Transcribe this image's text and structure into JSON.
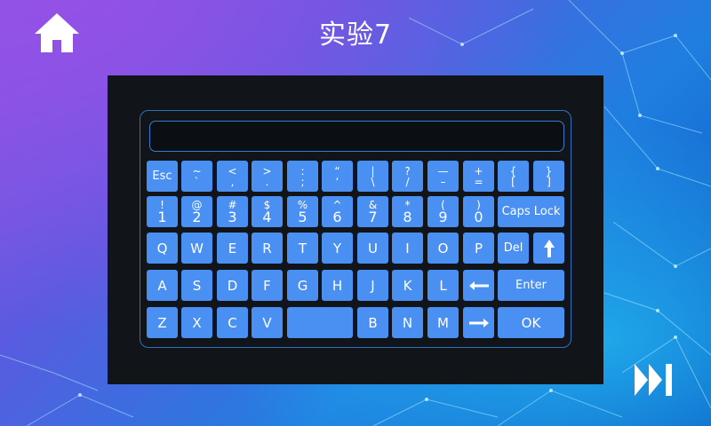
{
  "header": {
    "title": "实验7"
  },
  "icons": {
    "home": "home-icon",
    "skip": "fast-forward-icon",
    "backspace": "arrow-left-icon",
    "forward": "arrow-right-icon",
    "shift": "arrow-up-icon"
  },
  "colors": {
    "key": "#4a90f2",
    "panel": "#111519",
    "frame": "#2f6fbf"
  },
  "keyboard": {
    "display_value": "",
    "row1": [
      {
        "label": "Esc"
      },
      {
        "top": "~",
        "bottom": "`"
      },
      {
        "top": "<",
        "bottom": ","
      },
      {
        "top": ">",
        "bottom": "."
      },
      {
        "top": ":",
        "bottom": ";"
      },
      {
        "top": "“",
        "bottom": "‘"
      },
      {
        "top": "|",
        "bottom": "\\"
      },
      {
        "top": "?",
        "bottom": "/"
      },
      {
        "top": "—",
        "bottom": "–"
      },
      {
        "top": "+",
        "bottom": "="
      },
      {
        "top": "{",
        "bottom": "["
      },
      {
        "top": "}",
        "bottom": "]"
      }
    ],
    "row2": [
      {
        "top": "!",
        "bottom": "1"
      },
      {
        "top": "@",
        "bottom": "2"
      },
      {
        "top": "#",
        "bottom": "3"
      },
      {
        "top": "$",
        "bottom": "4"
      },
      {
        "top": "%",
        "bottom": "5"
      },
      {
        "top": "^",
        "bottom": "6"
      },
      {
        "top": "&",
        "bottom": "7"
      },
      {
        "top": "*",
        "bottom": "8"
      },
      {
        "top": "(",
        "bottom": "9"
      },
      {
        "top": ")",
        "bottom": "0"
      }
    ],
    "caps_label": "Caps Lock",
    "row3": [
      "Q",
      "W",
      "E",
      "R",
      "T",
      "Y",
      "U",
      "I",
      "O",
      "P"
    ],
    "del_label": "Del",
    "row4": [
      "A",
      "S",
      "D",
      "F",
      "G",
      "H",
      "J",
      "K",
      "L"
    ],
    "enter_label": "Enter",
    "row5a": [
      "Z",
      "X",
      "C",
      "V"
    ],
    "row5b": [
      "B",
      "N",
      "M"
    ],
    "ok_label": "OK"
  }
}
